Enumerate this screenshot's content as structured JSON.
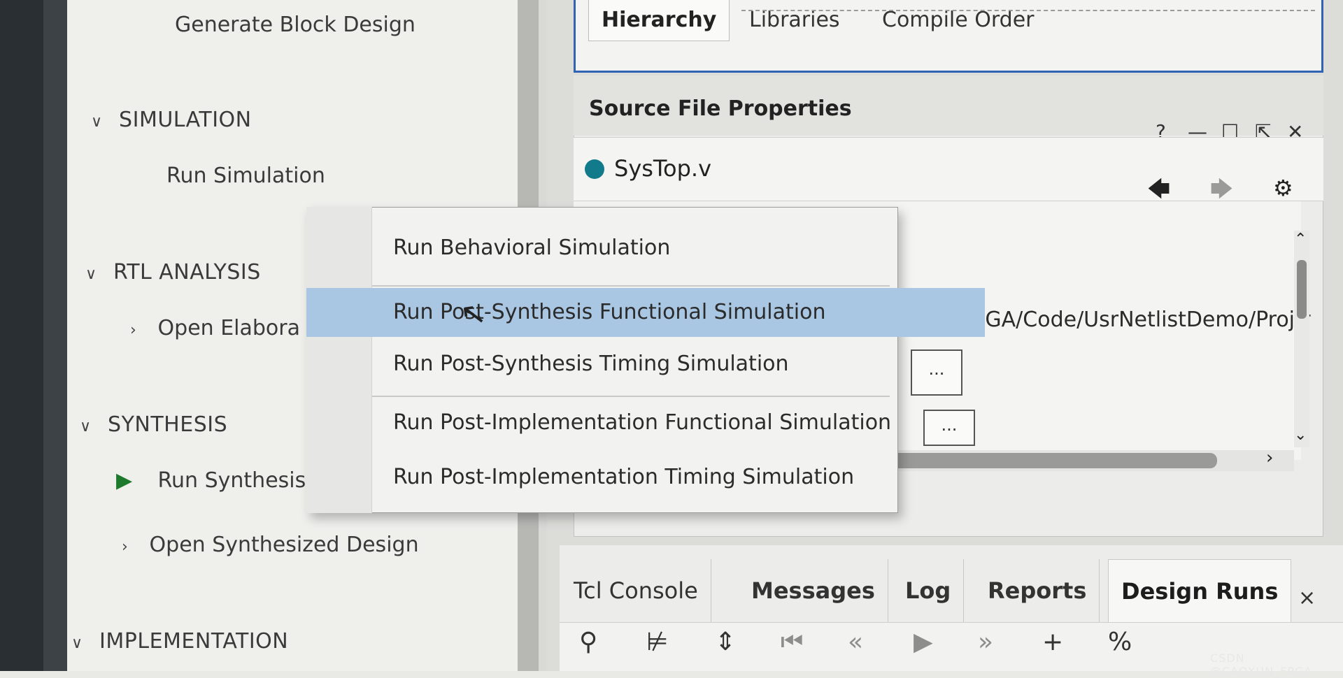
{
  "flow_navigator": {
    "generate_block_design": "Generate Block Design",
    "simulation": {
      "title": "SIMULATION",
      "run_simulation": "Run Simulation"
    },
    "rtl_analysis": {
      "title": "RTL ANALYSIS",
      "open_elaborated": "Open Elabora"
    },
    "synthesis": {
      "title": "SYNTHESIS",
      "run_synthesis": "Run Synthesis",
      "open_synthesized": "Open Synthesized Design"
    },
    "implementation": {
      "title": "IMPLEMENTATION"
    }
  },
  "sources_tabs": [
    "Hierarchy",
    "Libraries",
    "Compile Order"
  ],
  "source_file_properties": {
    "title": "Source File Properties",
    "file_name": "SysTop.v",
    "path": "elight/FPGA/Code/UsrNetlistDemo/Proj/r",
    "ellipsis": "...",
    "help": "?",
    "minimize": "—",
    "maximize": "☐",
    "float": "⇱",
    "close": "✕"
  },
  "context_menu": {
    "items": [
      "Run Behavioral Simulation",
      "Run Post-Synthesis Functional Simulation",
      "Run Post-Synthesis Timing Simulation",
      "Run Post-Implementation Functional Simulation",
      "Run Post-Implementation Timing Simulation"
    ],
    "highlighted_index": 1
  },
  "bottom_tabs": [
    "Tcl Console",
    "Messages",
    "Log",
    "Reports",
    "Design Runs"
  ],
  "bottom_close": "×",
  "toolbar_icons": [
    "search-icon",
    "collapse-all-icon",
    "expand-all-icon",
    "first-icon",
    "previous-icon",
    "play-icon",
    "next-icon",
    "plus-icon",
    "percent-icon"
  ],
  "watermark": "CSDN @CAOXUN_FPGA",
  "colors": {
    "accent_blue": "#2f63b5",
    "highlight": "#a9c7e2",
    "file_dot": "#117a8b",
    "run_green": "#1d7a2c"
  }
}
